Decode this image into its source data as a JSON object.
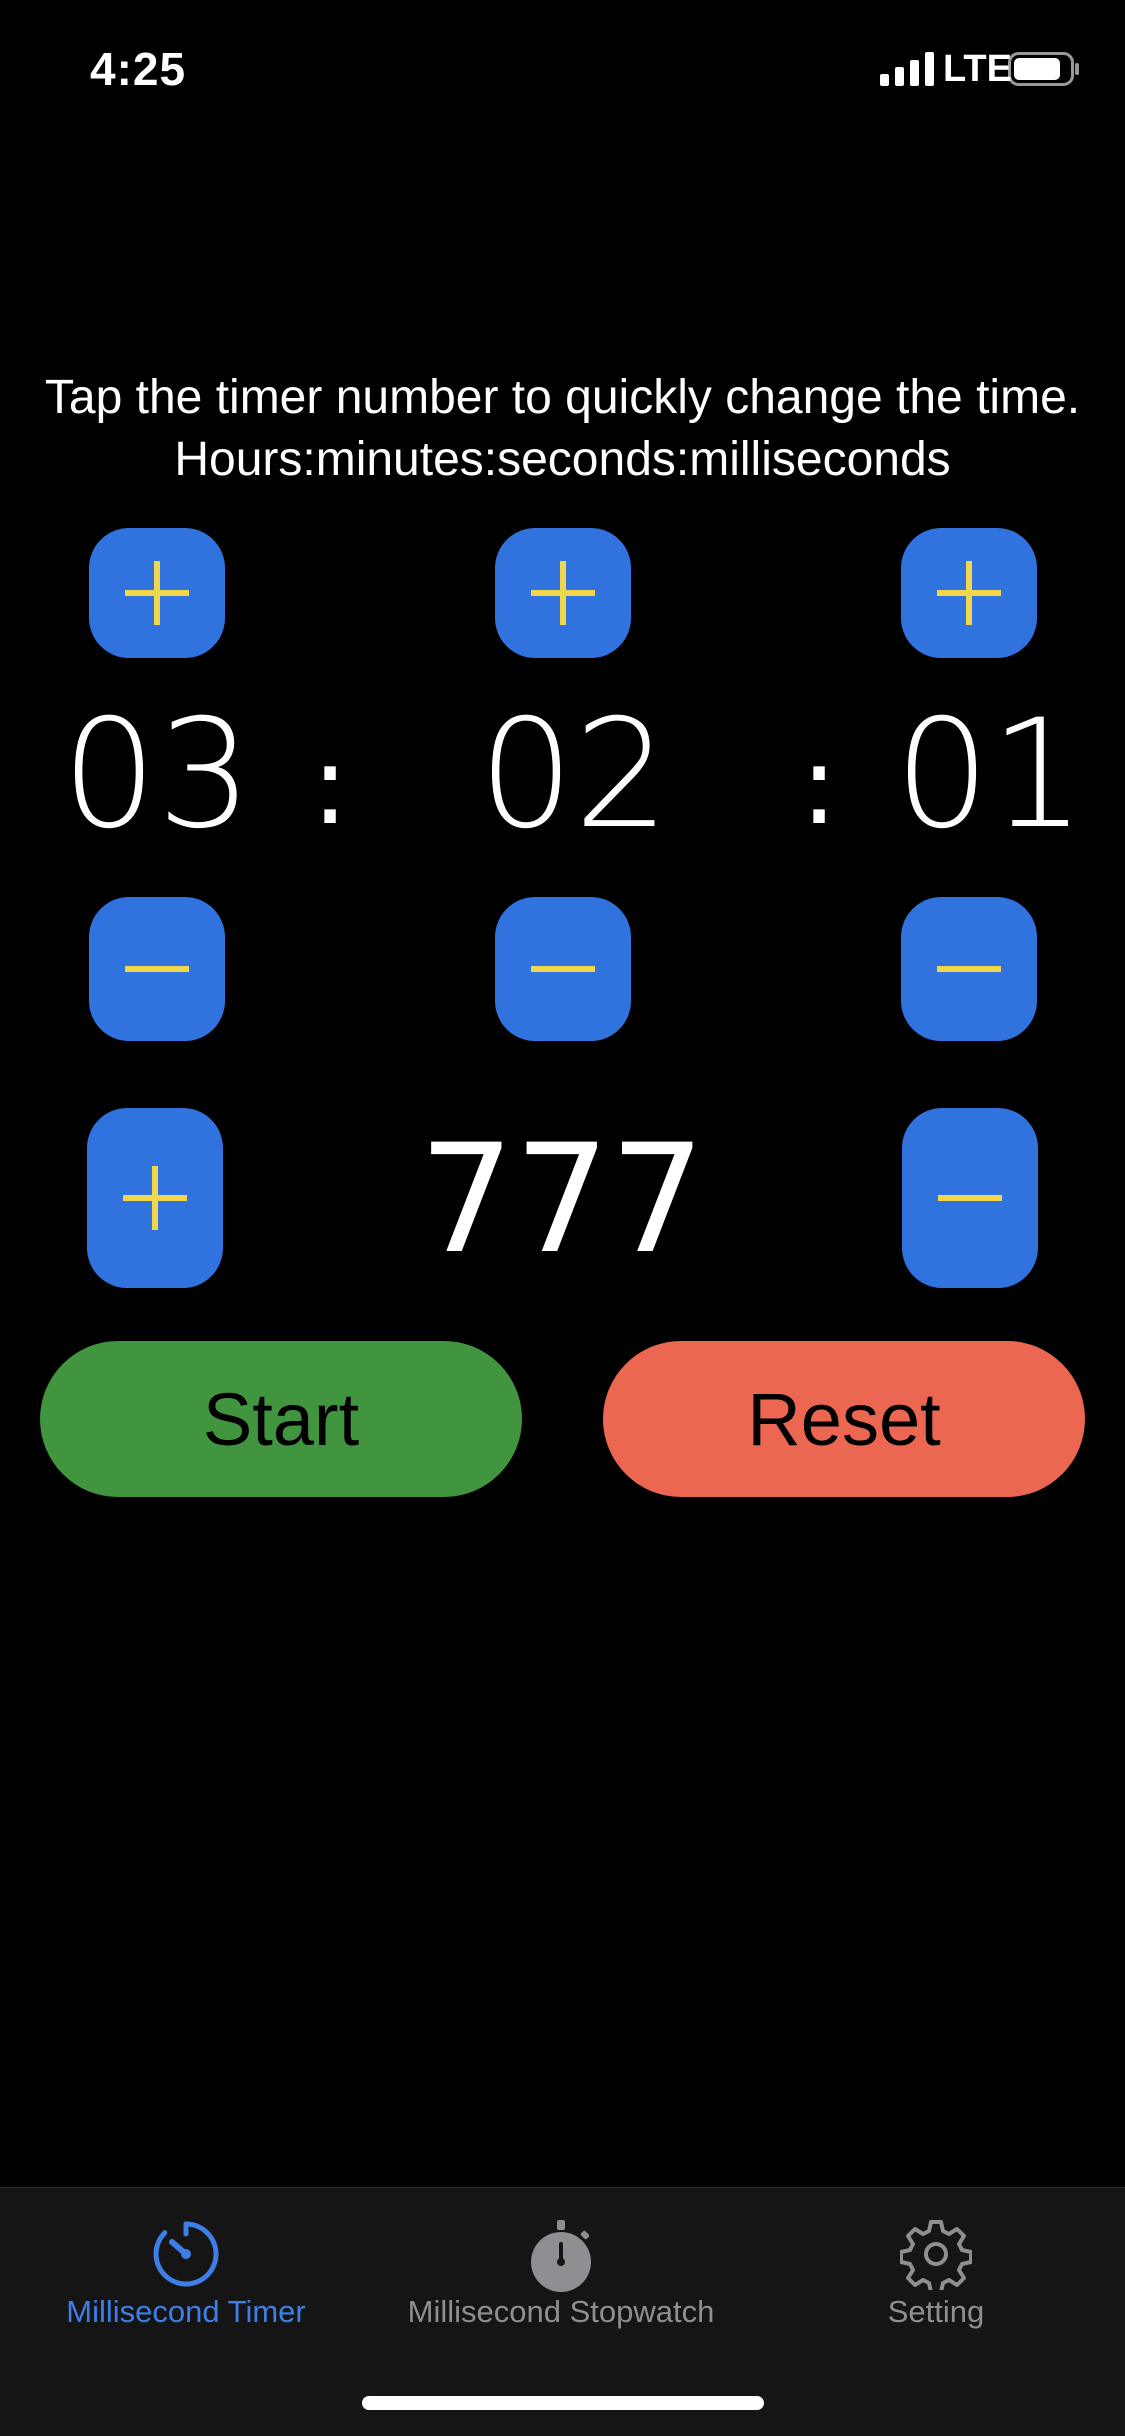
{
  "status_bar": {
    "time": "4:25",
    "network": "LTE"
  },
  "instructions": {
    "line1": "Tap the timer number to quickly change the time.",
    "line2": "Hours:minutes:seconds:milliseconds"
  },
  "timer": {
    "hours": "03",
    "minutes": "02",
    "seconds": "01",
    "separator": ":",
    "milliseconds": "777"
  },
  "buttons": {
    "start": "Start",
    "reset": "Reset"
  },
  "tabs": [
    {
      "label": "Millisecond Timer",
      "icon": "timer-icon",
      "active": true
    },
    {
      "label": "Millisecond Stopwatch",
      "icon": "stopwatch-icon",
      "active": false
    },
    {
      "label": "Setting",
      "icon": "gear-icon",
      "active": false
    }
  ],
  "colors": {
    "step_button": "#3173de",
    "step_glyph": "#f2d64b",
    "start": "#41953f",
    "reset": "#ec6752",
    "active_tab": "#3d7fe6",
    "inactive_tab": "#8e8e93"
  }
}
